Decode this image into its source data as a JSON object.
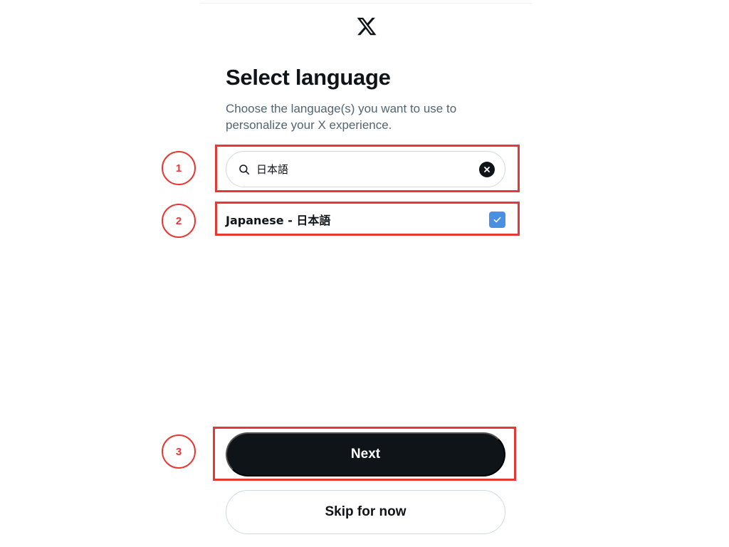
{
  "header": {
    "logo": "x-logo-icon"
  },
  "page": {
    "title": "Select language",
    "subtitle": "Choose the language(s) you want to use to personalize your X experience."
  },
  "search": {
    "icon": "search-icon",
    "value": "日本語",
    "clear_icon": "close-icon"
  },
  "languages": [
    {
      "label": "Japanese - 日本語",
      "checked": true
    }
  ],
  "actions": {
    "next_label": "Next",
    "skip_label": "Skip for now"
  },
  "annotations": [
    {
      "number": "1"
    },
    {
      "number": "2"
    },
    {
      "number": "3"
    }
  ],
  "colors": {
    "annotation": "#e53935",
    "checkbox": "#4a90e2",
    "primary_button": "#0f1419",
    "subtitle": "#536471"
  }
}
